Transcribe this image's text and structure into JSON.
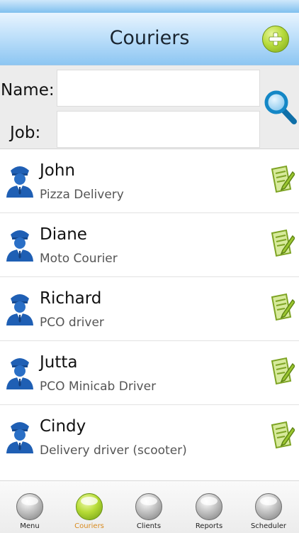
{
  "header": {
    "title": "Couriers"
  },
  "search": {
    "name_label": "Name:",
    "job_label": "Job:",
    "name_value": "",
    "job_value": ""
  },
  "couriers": [
    {
      "name": "John",
      "job": "Pizza Delivery"
    },
    {
      "name": "Diane",
      "job": "Moto Courier"
    },
    {
      "name": "Richard",
      "job": "PCO driver"
    },
    {
      "name": "Jutta",
      "job": "PCO Minicab Driver"
    },
    {
      "name": "Cindy",
      "job": "Delivery driver (scooter)"
    }
  ],
  "tabs": [
    {
      "label": "Menu"
    },
    {
      "label": "Couriers"
    },
    {
      "label": "Clients"
    },
    {
      "label": "Reports"
    },
    {
      "label": "Scheduler"
    }
  ],
  "active_tab": "Couriers",
  "icons": {
    "add": "plus-icon",
    "search": "magnifier-icon",
    "courier": "courier-person-icon",
    "edit": "edit-note-icon",
    "tab": "sphere-icon"
  },
  "colors": {
    "header_blue": "#8dc6f2",
    "accent_green": "#9cc730",
    "courier_blue": "#1f5fb4",
    "active_tab_label": "#d88a1e"
  }
}
